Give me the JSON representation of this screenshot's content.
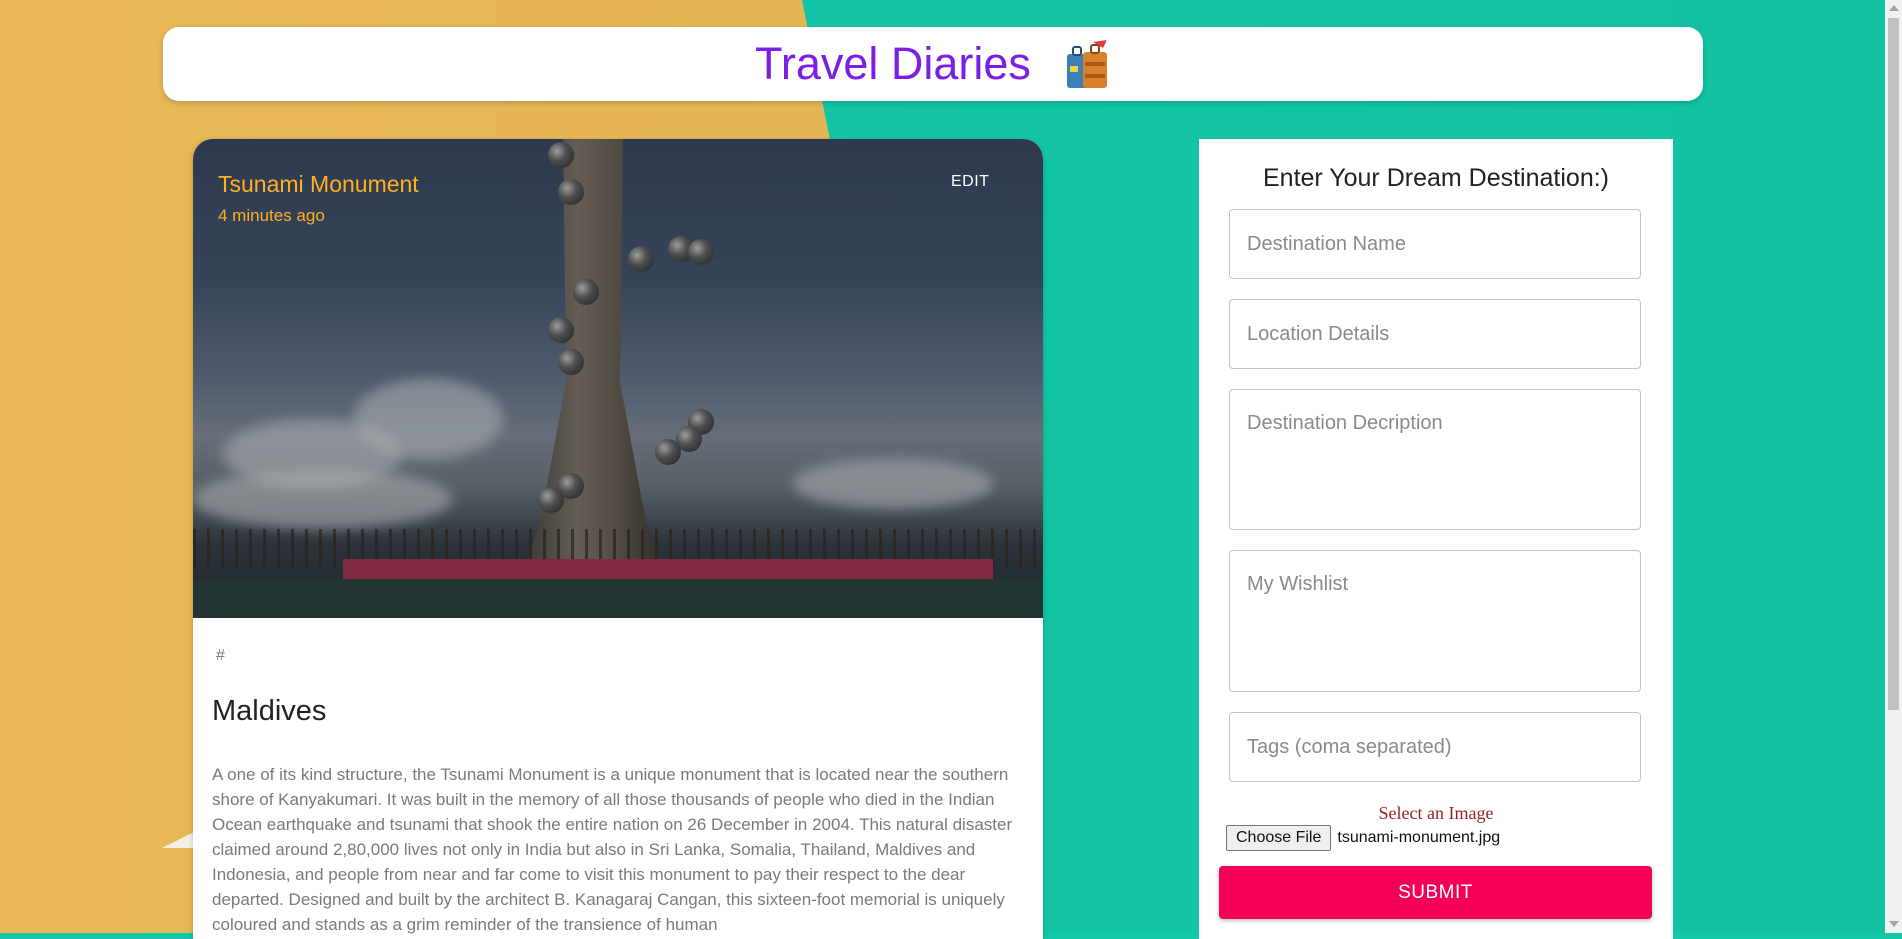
{
  "header": {
    "title": "Travel Diaries",
    "icon": "suitcase-icon"
  },
  "card": {
    "title": "Tsunami Monument",
    "time": "4 minutes ago",
    "edit_label": "EDIT",
    "tags": "#",
    "heading": "Maldives",
    "description": "A one of its kind structure, the Tsunami Monument is a unique monument that is located near the southern shore of Kanyakumari. It was built in the memory of all those thousands of people who died in the Indian Ocean earthquake and tsunami that shook the entire nation on 26 December in 2004. This natural disaster claimed around 2,80,000 lives not only in India but also in Sri Lanka, Somalia, Thailand, Maldives and Indonesia, and people from near and far come to visit this monument to pay their respect to the dear departed. Designed and built by the architect B. Kanagaraj Cangan, this sixteen-foot memorial is uniquely coloured and stands as a grim reminder of the transience of human"
  },
  "form": {
    "title": "Enter Your Dream Destination:)",
    "destination_placeholder": "Destination Name",
    "location_placeholder": "Location Details",
    "description_placeholder": "Destination Decription",
    "wishlist_placeholder": "My Wishlist",
    "tags_placeholder": "Tags (coma separated)",
    "image_label": "Select an Image",
    "choose_file_label": "Choose File",
    "file_name": "tsunami-monument.jpg",
    "submit_label": "SUBMIT"
  },
  "colors": {
    "title_purple": "#7b1fe6",
    "card_title_orange": "#ffb020",
    "submit_pink": "#f50057",
    "bg_teal": "#13c8a8",
    "bg_yellow": "#e8b857"
  }
}
